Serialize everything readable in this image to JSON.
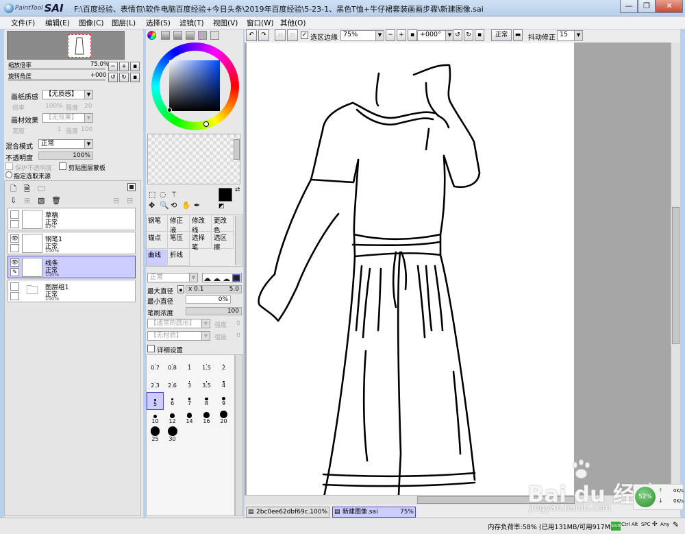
{
  "app": {
    "logo_small": "PaintTool",
    "logo_big": "SAI",
    "title": "F:\\百度经验、表情包\\软件电脑百度经验+今日头条\\2019年百度经验\\5-23-1、黑色T恤+牛仔裙套装画画步骤\\新建图像.sai"
  },
  "menu": [
    "文件(F)",
    "编辑(E)",
    "图像(C)",
    "图层(L)",
    "选择(S)",
    "滤镜(T)",
    "视图(V)",
    "窗口(W)",
    "其他(O)"
  ],
  "navigator": {
    "zoom_label": "缩放倍率",
    "zoom_value": "75.0%",
    "rotate_label": "旋转角度",
    "rotate_value": "+000"
  },
  "paper": {
    "texture_label": "画纸质感",
    "texture_value": "【无质感】",
    "scale_label": "倍率",
    "scale_value": "100%",
    "strength_label": "强度",
    "strength_value": "20",
    "effect_label": "画材效果",
    "effect_value": "【无效果】",
    "width_label": "宽度",
    "width_value": "1",
    "effect_strength_label": "强度",
    "effect_strength_value": "100"
  },
  "blend": {
    "mode_label": "混合模式",
    "mode_value": "正常",
    "opacity_label": "不透明度",
    "opacity_value": "100%",
    "protect_label": "保护不透明度",
    "clip_label": "剪贴图层蒙板",
    "source_label": "指定选取来源"
  },
  "layers": [
    {
      "name": "草稿",
      "mode": "正常",
      "opacity": "42%",
      "visible": false,
      "selected": false
    },
    {
      "name": "钢笔1",
      "mode": "正常",
      "opacity": "100%",
      "visible": true,
      "selected": false
    },
    {
      "name": "线条",
      "mode": "正常",
      "opacity": "100%",
      "visible": true,
      "selected": true
    },
    {
      "name": "图层组1",
      "mode": "正常",
      "opacity": "100%",
      "visible": false,
      "selected": false
    }
  ],
  "tools": [
    [
      "钢笔",
      "修正液",
      "修改线",
      "更改色"
    ],
    [
      "锚点",
      "笔压",
      "选择笔",
      "选区擦"
    ],
    [
      "曲线",
      "折线",
      "",
      ""
    ]
  ],
  "brush": {
    "mode_value": "正常",
    "max_diameter_label": "最大直径",
    "max_mult": "x 0.1",
    "max_value": "5.0",
    "min_diameter_label": "最小直径",
    "min_value": "0%",
    "density_label": "笔刷浓度",
    "density_value": "100",
    "shape_value": "【通常的圆形】",
    "shape_strength_label": "强度",
    "shape_strength_value": "0",
    "material_value": "【无材质】",
    "material_strength_label": "强度",
    "material_strength_value": "0",
    "detail_label": "详细设置"
  },
  "brush_sizes": [
    "0.7",
    "0.8",
    "1",
    "1.5",
    "2",
    "2.3",
    "2.6",
    "3",
    "3.5",
    "4",
    "5",
    "6",
    "7",
    "8",
    "9",
    "10",
    "12",
    "14",
    "16",
    "20",
    "25",
    "30"
  ],
  "canvas_toolbar": {
    "selection_label": "选区边缘",
    "zoom_value": "75%",
    "angle_value": "+000°",
    "mode_value": "正常",
    "stabilizer_label": "抖动修正",
    "stabilizer_value": "15"
  },
  "tabs": [
    {
      "name": "2bc0ee62dbf69c...",
      "zoom": "100%"
    },
    {
      "name": "新建图像.sai",
      "zoom": "75%"
    }
  ],
  "status": {
    "memory": "内存负荷率:58% (已用131MB/可用917MB)",
    "keys": [
      "Shift",
      "Ctrl",
      "Alt",
      "SPC",
      "Any"
    ]
  },
  "watermark": {
    "main": "Bai du 经验",
    "url": "jingyan.baidu.com"
  },
  "network": {
    "percent": "52%",
    "up": "0K/s",
    "down": "0K/s"
  }
}
